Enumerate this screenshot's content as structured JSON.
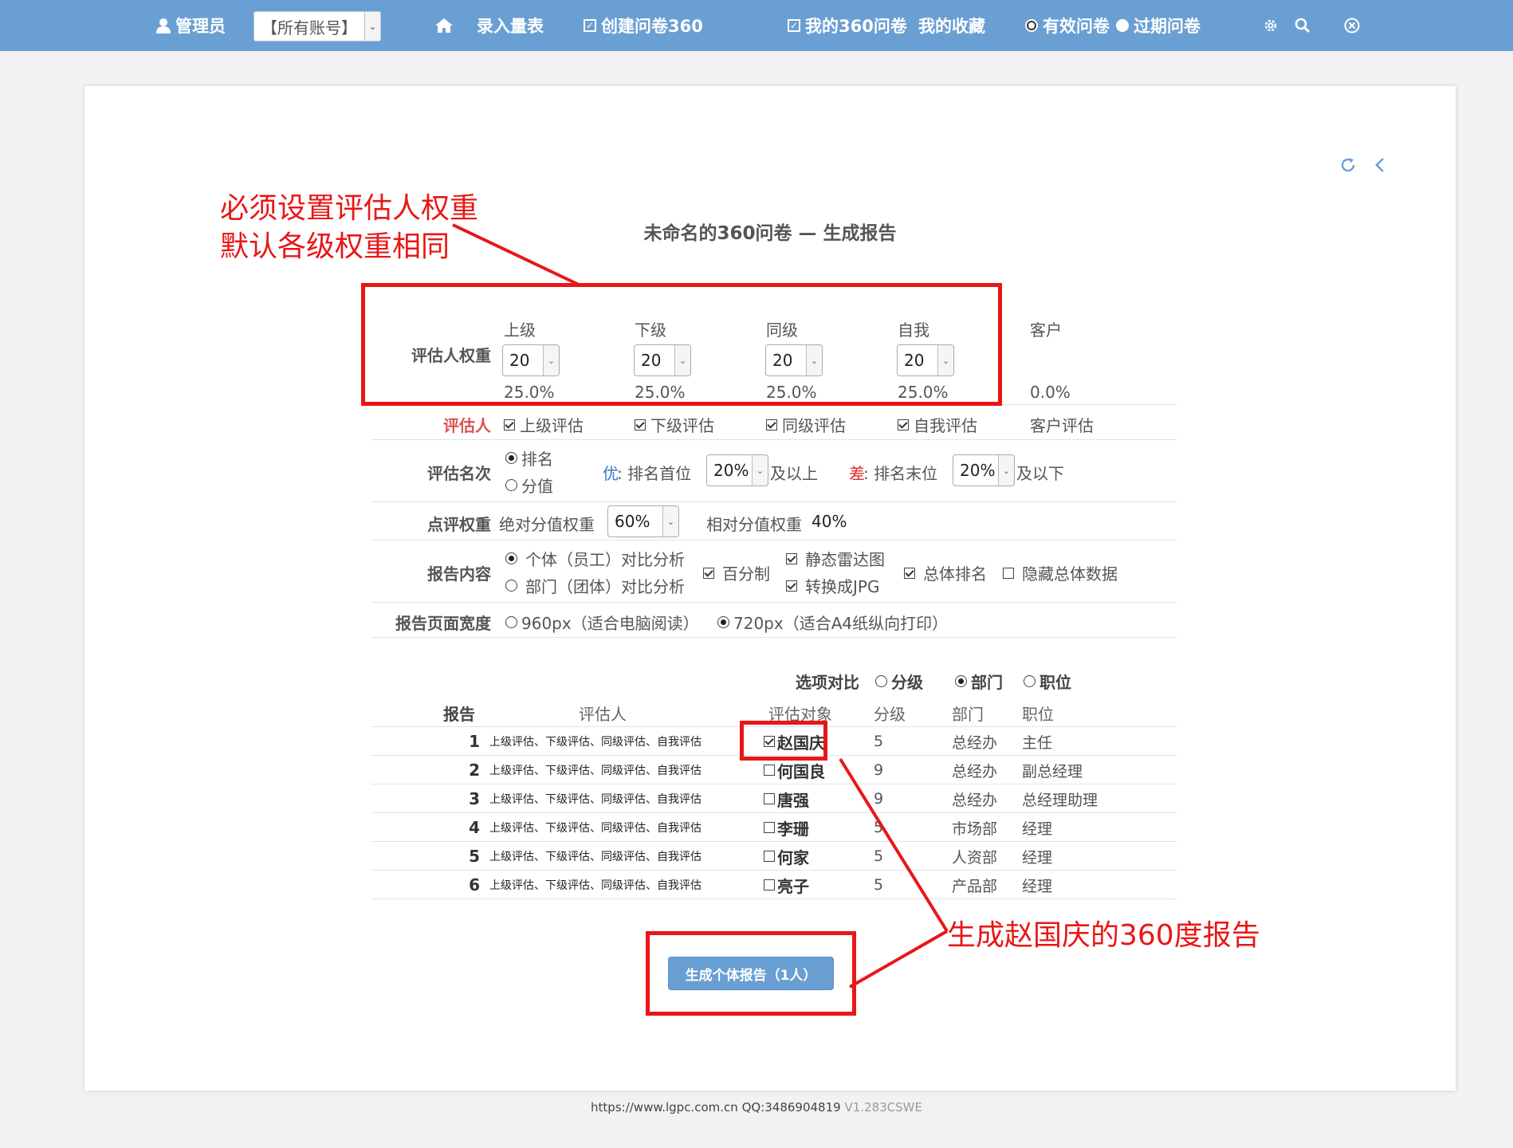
{
  "nav": {
    "user": "管理员",
    "account_select": "【所有账号】",
    "home": "",
    "enter_scale": "录入量表",
    "create": "创建问卷360",
    "my360": "我的360问卷",
    "favorites": "我的收藏",
    "valid": "有效问卷",
    "expired": "过期问卷"
  },
  "page": {
    "title": "未命名的360问卷 — 生成报告"
  },
  "weights": {
    "label": "评估人权重",
    "columns": [
      {
        "name": "上级",
        "value": "20",
        "percent": "25.0%"
      },
      {
        "name": "下级",
        "value": "20",
        "percent": "25.0%"
      },
      {
        "name": "同级",
        "value": "20",
        "percent": "25.0%"
      },
      {
        "name": "自我",
        "value": "20",
        "percent": "25.0%"
      },
      {
        "name": "客户",
        "percent": "0.0%"
      }
    ]
  },
  "evaluators": {
    "label": "评估人",
    "items": [
      "上级评估",
      "下级评估",
      "同级评估",
      "自我评估",
      "客户评估"
    ]
  },
  "ranking": {
    "label": "评估名次",
    "opt_rank": "排名",
    "opt_score": "分值",
    "good_label": "优",
    "good_text": ": 排名首位",
    "good_value": "20%",
    "good_suffix": "及以上",
    "bad_label": "差",
    "bad_text": ": 排名末位",
    "bad_value": "20%",
    "bad_suffix": "及以下"
  },
  "review_weight": {
    "label": "点评权重",
    "abs_text": "绝对分值权重",
    "abs_value": "60%",
    "rel_text": "相对分值权重",
    "rel_value": "40%"
  },
  "content": {
    "label": "报告内容",
    "individual": "个体（员工）对比分析",
    "department": "部门（团体）对比分析",
    "percent": "百分制",
    "radar": "静态雷达图",
    "jpg": "转换成JPG",
    "overall_rank": "总体排名",
    "hide_overall": "隐藏总体数据"
  },
  "width": {
    "label": "报告页面宽度",
    "opt960": "960px（适合电脑阅读）",
    "opt720": "720px（适合A4纸纵向打印）"
  },
  "compare": {
    "label": "选项对比",
    "level": "分级",
    "dept": "部门",
    "pos": "职位"
  },
  "table": {
    "headers": {
      "report": "报告",
      "evaluators": "评估人",
      "target": "评估对象",
      "level": "分级",
      "dept": "部门",
      "pos": "职位"
    },
    "rows": [
      {
        "n": "1",
        "evals": "上级评估、下级评估、同级评估、自我评估",
        "name": "赵国庆",
        "level": "5",
        "dept": "总经办",
        "pos": "主任"
      },
      {
        "n": "2",
        "evals": "上级评估、下级评估、同级评估、自我评估",
        "name": "何国良",
        "level": "9",
        "dept": "总经办",
        "pos": "副总经理"
      },
      {
        "n": "3",
        "evals": "上级评估、下级评估、同级评估、自我评估",
        "name": "唐强",
        "level": "9",
        "dept": "总经办",
        "pos": "总经理助理"
      },
      {
        "n": "4",
        "evals": "上级评估、下级评估、同级评估、自我评估",
        "name": "李珊",
        "level": "5",
        "dept": "市场部",
        "pos": "经理"
      },
      {
        "n": "5",
        "evals": "上级评估、下级评估、同级评估、自我评估",
        "name": "何家",
        "level": "5",
        "dept": "人资部",
        "pos": "经理"
      },
      {
        "n": "6",
        "evals": "上级评估、下级评估、同级评估、自我评估",
        "name": "亮子",
        "level": "5",
        "dept": "产品部",
        "pos": "经理"
      }
    ]
  },
  "generate_button": "生成个体报告（1人）",
  "annotations": {
    "top_line1": "必须设置评估人权重",
    "top_line2": "默认各级权重相同",
    "right": "生成赵国庆的360度报告"
  },
  "footer": {
    "site": "https://www.lgpc.com.cn",
    "qq": "QQ:3486904819",
    "version": "V1.283CSWE"
  },
  "colors": {
    "nav": "#6a9fd3",
    "annotation": "#e81717",
    "evaluator_label": "#d9534f",
    "good": "#3a76c4",
    "bad": "#d9302c"
  }
}
